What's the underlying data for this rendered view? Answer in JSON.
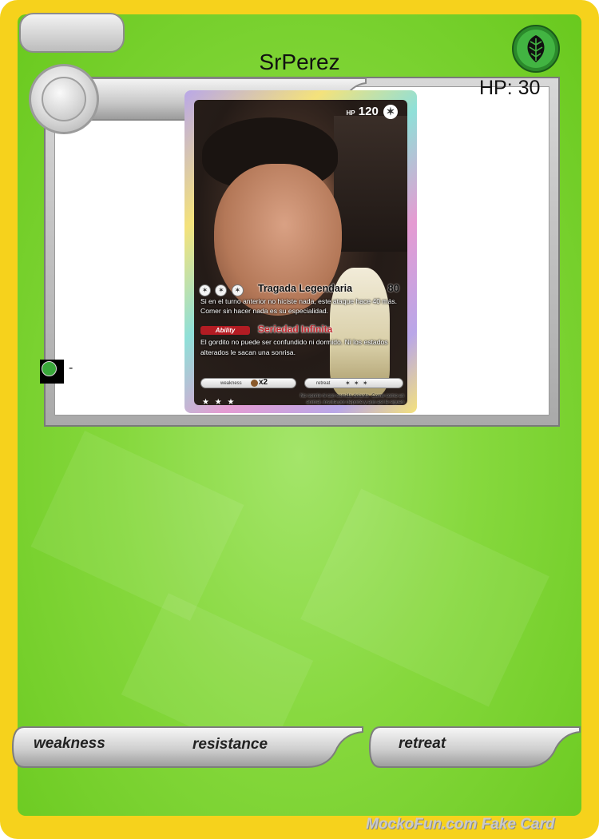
{
  "card": {
    "name": "SrPerez",
    "hp_text": "HP: 30",
    "type_icon": "grass-leaf-icon",
    "evolves_from": "-",
    "colors": {
      "border": "#f6d21c",
      "body": "#86d83d",
      "type_orb": "#3aa83a"
    }
  },
  "inner_card": {
    "hp_label": "HP",
    "hp_value": "120",
    "attack": {
      "cost": [
        "✶",
        "✶",
        "✶"
      ],
      "name": "Tragada Legendaria",
      "damage": "80",
      "text": "Si en el turno anterior no hiciste nada, este ataque hace 40 más. Comer sin hacer nada es su especialidad."
    },
    "ability": {
      "tag": "Ability",
      "name": "Seriedad Infinita",
      "text": "El gordito no puede ser confundido ni dormido. Ni los estados alterados le sacan una sonrisa."
    },
    "weakness_label": "weakness",
    "weakness_value": "x2",
    "retreat_label": "retreat",
    "retreat_cost": "✶ ✶ ✶",
    "rarity": "★ ★ ★",
    "flavor": "No sonríe ni con comida delante. Come como un animal, insulta por deporte y aun así le siguen hablando. Misterios de la vida."
  },
  "footer": {
    "weakness": "weakness",
    "resistance": "resistance",
    "retreat": "retreat",
    "watermark": "MockoFun.com Fake Card"
  }
}
